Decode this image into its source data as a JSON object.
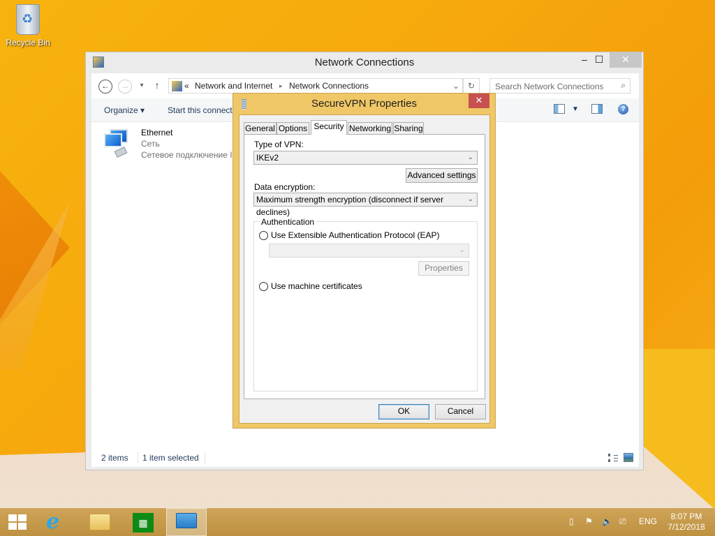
{
  "desktop": {
    "icons": [
      {
        "label": "Recycle Bin",
        "icon": "recycle-bin-icon"
      }
    ]
  },
  "explorer": {
    "title": "Network Connections",
    "caption_buttons": {
      "minimize": "‒",
      "maximize": "☐",
      "close": "✕"
    },
    "nav": {
      "back": "←",
      "forward": "→",
      "recent": "▾",
      "up": "↑",
      "breadcrumb": [
        "«",
        "Network and Internet",
        "▸",
        "Network Connections"
      ],
      "address_dropdown": "⌄",
      "refresh": "↻",
      "search_placeholder": "Search Network Connections",
      "search_icon": "⌕"
    },
    "commandbar": {
      "organize": "Organize ▾",
      "start_connection": "Start this connection"
    },
    "items": [
      {
        "name": "Ethernet",
        "line2": "Сеть",
        "line3": "Сетевое подключение Intel(R)"
      }
    ],
    "status": {
      "count": "2 items",
      "selected": "1 item selected"
    }
  },
  "dialog": {
    "title": "SecureVPN Properties",
    "close": "✕",
    "tabs": [
      {
        "label": "General",
        "active": false
      },
      {
        "label": "Options",
        "active": false
      },
      {
        "label": "Security",
        "active": true
      },
      {
        "label": "Networking",
        "active": false
      },
      {
        "label": "Sharing",
        "active": false
      }
    ],
    "type_of_vpn_label": "Type of VPN:",
    "type_of_vpn_value": "IKEv2",
    "advanced_settings": "Advanced settings",
    "data_encryption_label": "Data encryption:",
    "data_encryption_value": "Maximum strength encryption (disconnect if server declines)",
    "authentication_label": "Authentication",
    "eap_option": "Use Extensible Authentication Protocol (EAP)",
    "eap_value": "",
    "properties": "Properties",
    "machine_cert_option": "Use machine certificates",
    "ok": "OK",
    "cancel": "Cancel",
    "dropdown_arrow": "⌄"
  },
  "taskbar": {
    "tray": {
      "language": "ENG",
      "time": "8:07 PM",
      "date": "7/12/2018"
    }
  }
}
